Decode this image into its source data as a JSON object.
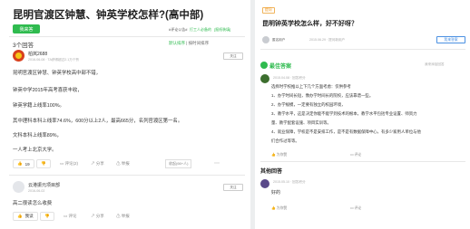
{
  "left": {
    "title": "昆明官渡区钟慧、钟英学校怎样?(高中部)",
    "answer_button": "我来答",
    "top_links": [
      "#评论公告#",
      "打工人必备的",
      "[报纸装填]"
    ],
    "answer_count": "3个回答",
    "sort": {
      "default": "默认排序",
      "latest": "按时间排序"
    },
    "answers": [
      {
        "user": "柏岚2688",
        "meta": "2016-06-08 · TA获得超过2.1万个赞",
        "follow": "关注",
        "lines": [
          "昆明官渡区钟慧、钟英学校高中部不错，",
          "",
          "钟英中学2015年高考喜获丰收，",
          "",
          "钟英学籍上线率100%。",
          "",
          "其中理科本科上线率74.6%，600分以上2人，最高665分，名列官渡区第一名。",
          "",
          "文科本科上线率89%，",
          "",
          "一人考上北京大学。"
        ],
        "likes": "19",
        "comment": "评论(2)",
        "share": "分享",
        "report": "举报",
        "collapse": "收起(66+人)"
      },
      {
        "user": "云港振元项目部",
        "meta": "2016-06-02",
        "follow": "关注",
        "lines": [
          "高二很读怎么收费"
        ],
        "likes": "我读",
        "comment": "评论",
        "share": "分享",
        "report": "举报"
      }
    ]
  },
  "right": {
    "tag": "提问",
    "title": "昆明钟英学校怎么样，好不好呀？",
    "asker": "匿名用户",
    "asked_meta": "2015.06.29 · 提问新用户",
    "follow_button": "我来答案",
    "best_label": "最佳答案",
    "best_meta": "2015.04.08 · 回答积分",
    "report_link": "我来添加回答",
    "best_lines": [
      "选择时学校推以上下几个方面考虑：仅供参考",
      "1、办学时间长短，像办学时间长的院校，应该靠谱一些。",
      "2、办学规模，一定要有独立的校园环境，",
      "3、教学水平，这是决定你能不能学到技术的根本，教学水平包括专业设置、师资力",
      "量、教学配套设施、项目实训等。",
      "4、就业保障，学校是不是安排工作，是不是有数据保障中心，有多少家用人单位与他",
      "们合作过等等。"
    ],
    "best_actions": [
      "为你赞",
      "评论"
    ],
    "other_title": "其他回答",
    "other_meta": "2015.05.10 · 回答积分",
    "other_text": "好的",
    "other_actions": [
      "为你赞",
      "评论"
    ]
  }
}
